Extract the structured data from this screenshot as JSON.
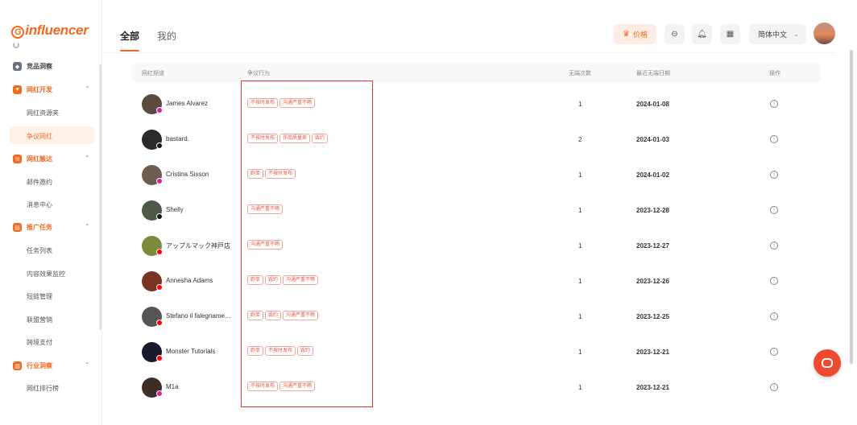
{
  "brand": {
    "logo_text": "influencer",
    "accent_color": "#f26a22"
  },
  "sidebar": {
    "groups": [
      {
        "label": "竞品洞察",
        "icon": "shield-icon",
        "color": "#6b7280",
        "expanded": false,
        "items": []
      },
      {
        "label": "网红开发",
        "icon": "heart-icon",
        "color": "#f26a22",
        "expanded": true,
        "items": [
          "网红资源夹",
          "争议网红"
        ]
      },
      {
        "label": "网红触达",
        "icon": "mail-icon",
        "color": "#f26a22",
        "expanded": true,
        "items": [
          "邮件邀约",
          "消息中心"
        ]
      },
      {
        "label": "推广任务",
        "icon": "document-icon",
        "color": "#f26a22",
        "expanded": true,
        "items": [
          "任务列表",
          "内容效果监控",
          "短链管理",
          "联盟营销",
          "跨境支付"
        ]
      },
      {
        "label": "行业洞察",
        "icon": "chart-icon",
        "color": "#f26a22",
        "expanded": true,
        "items": [
          "网红排行榜"
        ]
      }
    ],
    "active_item": "争议网红"
  },
  "header": {
    "tabs": [
      {
        "label": "全部",
        "active": true
      },
      {
        "label": "我的",
        "active": false
      }
    ],
    "price_label": "价格",
    "language": "简体中文"
  },
  "table": {
    "columns": [
      "网红频道",
      "争议行为",
      "无端次数",
      "最近无端日期",
      "操作"
    ],
    "rows": [
      {
        "name": "James Alvarez",
        "platform": "instagram",
        "tags": [
          "不按时发布",
          "沟通严重不畅"
        ],
        "count": "1",
        "date": "2024-01-08"
      },
      {
        "name": "bastard.",
        "platform": "tiktok",
        "tags": [
          "不按时发布",
          "作品质量差",
          "毁约"
        ],
        "count": "2",
        "date": "2024-01-03"
      },
      {
        "name": "Cristina Sisson",
        "platform": "instagram",
        "tags": [
          "跑单",
          "不按时发布"
        ],
        "count": "1",
        "date": "2024-01-02"
      },
      {
        "name": "Shelly",
        "platform": "tiktok",
        "tags": [
          "沟通严重不畅"
        ],
        "count": "1",
        "date": "2023-12-28"
      },
      {
        "name": "アップルマック神戸店",
        "platform": "youtube",
        "tags": [
          "沟通严重不畅"
        ],
        "count": "1",
        "date": "2023-12-27"
      },
      {
        "name": "Annesha Adams",
        "platform": "youtube",
        "tags": [
          "跑单",
          "毁约",
          "沟通严重不畅"
        ],
        "count": "1",
        "date": "2023-12-26"
      },
      {
        "name": "Stefano il falegname…",
        "platform": "youtube",
        "tags": [
          "跑单",
          "毁约",
          "沟通严重不畅"
        ],
        "count": "1",
        "date": "2023-12-25"
      },
      {
        "name": "Monster Tutorials",
        "platform": "youtube",
        "tags": [
          "跑单",
          "不按时发布",
          "毁约"
        ],
        "count": "1",
        "date": "2023-12-21"
      },
      {
        "name": "M1a",
        "platform": "instagram",
        "tags": [
          "不按时发布",
          "沟通严重不畅"
        ],
        "count": "1",
        "date": "2023-12-21"
      }
    ]
  }
}
